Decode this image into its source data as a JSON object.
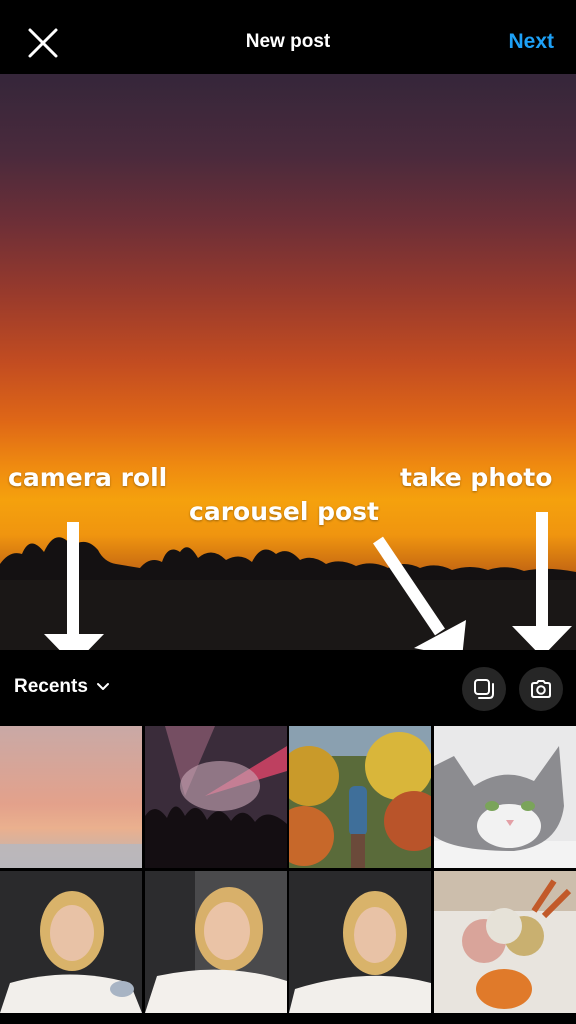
{
  "header": {
    "title": "New post",
    "next_label": "Next",
    "close_icon": "close-icon",
    "accent_color": "#1ea1f7"
  },
  "annotations": {
    "camera_roll": "camera roll",
    "carousel_post": "carousel post",
    "take_photo": "take photo"
  },
  "toolbar": {
    "album_label": "Recents",
    "album_icon": "chevron-down-icon",
    "multi_select_icon": "multi-select-icon",
    "camera_icon": "camera-icon"
  },
  "grid": {
    "thumbnails": [
      "pink sunset over fog",
      "concert crowd with stage lights",
      "hiker on autumn trail",
      "grey and white cat",
      "woman selfie kissing face",
      "woman selfie smiling",
      "woman selfie",
      "autumn flower arrangement in pumpkin"
    ]
  }
}
